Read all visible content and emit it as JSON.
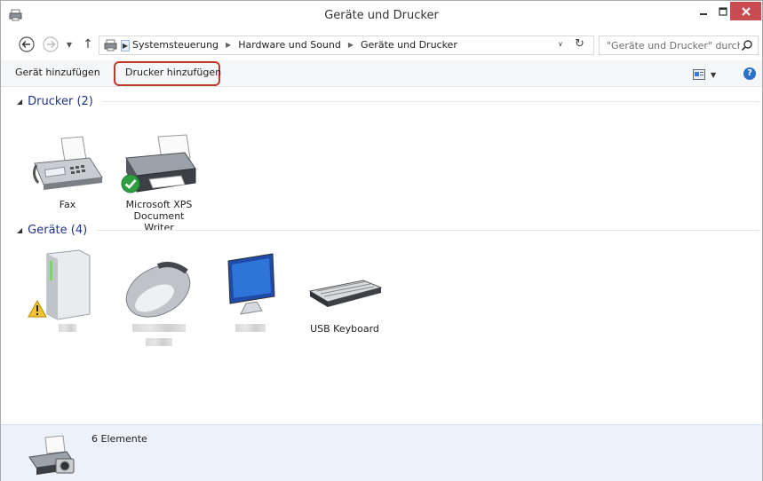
{
  "window": {
    "title": "Geräte und Drucker"
  },
  "address": {
    "crumbs": [
      "Systemsteuerung",
      "Hardware und Sound",
      "Geräte und Drucker"
    ]
  },
  "search": {
    "placeholder": "\"Geräte und Drucker\" durchsu..."
  },
  "commands": {
    "add_device": "Gerät hinzufügen",
    "add_printer": "Drucker hinzufügen"
  },
  "groups": {
    "printers": {
      "title": "Drucker (2)",
      "items": [
        {
          "label": "Fax",
          "icon": "fax-icon"
        },
        {
          "label": "Microsoft XPS Document Writer",
          "icon": "printer-icon",
          "default": true
        }
      ]
    },
    "devices": {
      "title": "Geräte (4)",
      "items": [
        {
          "label": "",
          "icon": "external-drive-icon",
          "warning": true,
          "redacted": true
        },
        {
          "label": "",
          "icon": "mouse-icon",
          "redacted": true
        },
        {
          "label": "",
          "icon": "monitor-icon",
          "redacted": true
        },
        {
          "label": "USB Keyboard",
          "icon": "keyboard-icon"
        }
      ]
    }
  },
  "status": {
    "count_text": "6 Elemente"
  },
  "colors": {
    "close_button": "#c74b50",
    "highlight_frame": "#c0392b",
    "group_title": "#1e3287",
    "status_bg": "#edf2fa",
    "default_check": "#2ea043"
  }
}
